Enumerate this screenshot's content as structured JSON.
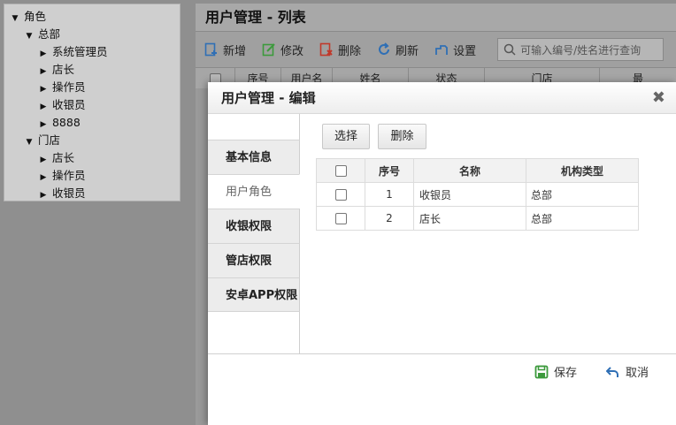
{
  "tree": [
    {
      "label": "角色",
      "level": 0,
      "toggle": "▼"
    },
    {
      "label": "总部",
      "level": 1,
      "toggle": "▼"
    },
    {
      "label": "系统管理员",
      "level": 2,
      "toggle": "▶"
    },
    {
      "label": "店长",
      "level": 2,
      "toggle": "▶"
    },
    {
      "label": "操作员",
      "level": 2,
      "toggle": "▶"
    },
    {
      "label": "收银员",
      "level": 2,
      "toggle": "▶"
    },
    {
      "label": "8888",
      "level": 2,
      "toggle": "▶"
    },
    {
      "label": "门店",
      "level": 1,
      "toggle": "▼"
    },
    {
      "label": "店长",
      "level": 2,
      "toggle": "▶"
    },
    {
      "label": "操作员",
      "level": 2,
      "toggle": "▶"
    },
    {
      "label": "收银员",
      "level": 2,
      "toggle": "▶"
    }
  ],
  "main": {
    "title": "用户管理 - 列表",
    "toolbar": {
      "add": "新增",
      "edit": "修改",
      "delete": "删除",
      "refresh": "刷新",
      "settings": "设置"
    },
    "search_placeholder": "可输入编号/姓名进行查询",
    "columns": [
      "序号",
      "用户名",
      "姓名",
      "状态",
      "门店",
      "最"
    ]
  },
  "modal": {
    "title": "用户管理 - 编辑",
    "close": "✖",
    "tabs": [
      "基本信息",
      "用户角色",
      "收银权限",
      "管店权限",
      "安卓APP权限"
    ],
    "active_tab": 1,
    "select_button": "选择",
    "delete_button": "删除",
    "grid": {
      "headers": [
        "序号",
        "名称",
        "机构类型"
      ],
      "rows": [
        {
          "index": "1",
          "name": "收银员",
          "type": "总部"
        },
        {
          "index": "2",
          "name": "店长",
          "type": "总部"
        }
      ]
    },
    "save": "保存",
    "cancel": "取消"
  },
  "colors": {
    "accent_green": "#3c9a3c",
    "accent_blue": "#2f6fb5",
    "accent_red": "#c0392b"
  }
}
